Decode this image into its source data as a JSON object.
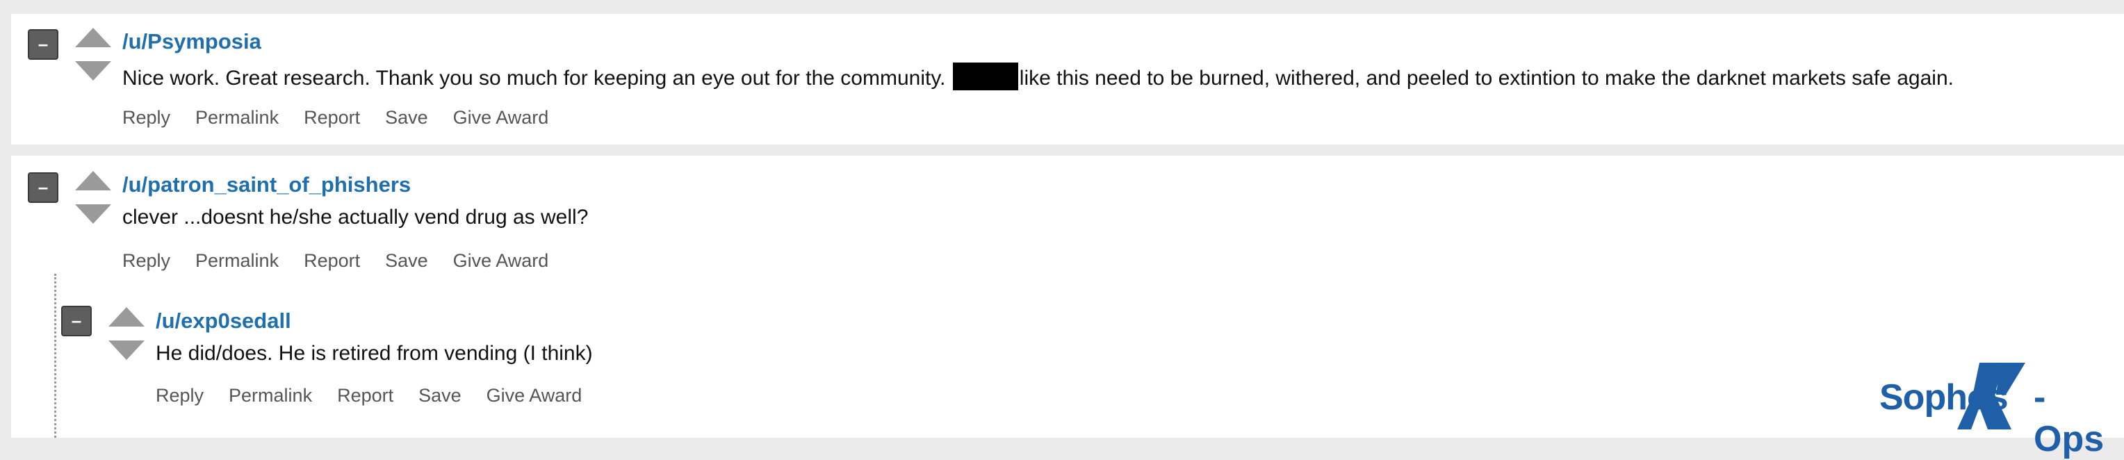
{
  "comments": [
    {
      "collapse_symbol": "–",
      "username": "/u/Psymposia",
      "text_before": "Nice work. Great research. Thank you so much for keeping an eye out for the community.",
      "text_after": "like this need to be burned, withered, and peeled to extintion to make the darknet markets safe again."
    },
    {
      "collapse_symbol": "–",
      "username": "/u/patron_saint_of_phishers",
      "text": "clever ...doesnt he/she actually vend drug as well?"
    },
    {
      "collapse_symbol": "–",
      "username": "/u/exp0sedall",
      "text": "He did/does. He is retired from vending (I think)"
    }
  ],
  "actions": {
    "reply": "Reply",
    "permalink": "Permalink",
    "report": "Report",
    "save": "Save",
    "give_award": "Give Award"
  },
  "logo": {
    "left_text": "Sophos",
    "right_text": "-Ops",
    "mark": "X"
  },
  "colors": {
    "username": "#1f6fae",
    "logo": "#1f5fa8",
    "background": "#ebebeb",
    "panel": "#ffffff"
  }
}
